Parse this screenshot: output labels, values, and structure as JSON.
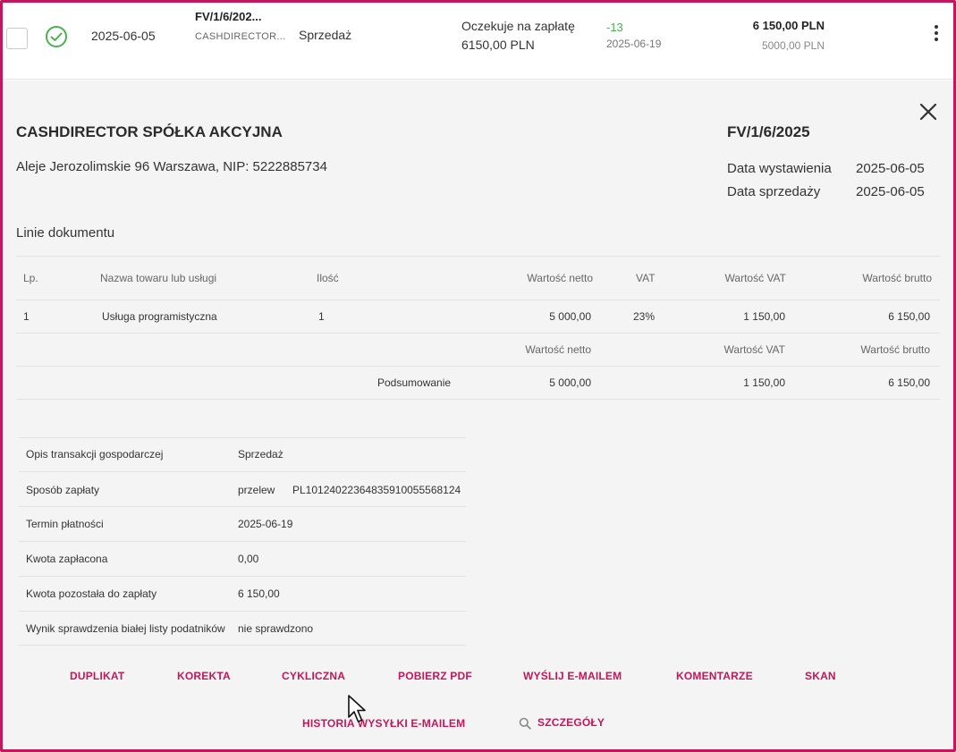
{
  "row": {
    "date": "2025-06-05",
    "number": "FV/1/6/202...",
    "client": "CASHDIRECTOR...",
    "type": "Sprzedaż",
    "status": "Oczekuje na zapłatę",
    "status_amount": "6150,00 PLN",
    "days": "-13",
    "due_date": "2025-06-19",
    "gross": "6 150,00 PLN",
    "net": "5000,00 PLN",
    "status_color": "#4caf50"
  },
  "details": {
    "company": "CASHDIRECTOR SPÓŁKA AKCYJNA",
    "address": "Aleje Jerozolimskie 96 Warszawa, NIP: 5222885734",
    "doc_number": "FV/1/6/2025",
    "issue_label": "Data wystawienia",
    "issue_date": "2025-06-05",
    "sale_label": "Data sprzedaży",
    "sale_date": "2025-06-05",
    "lines_title": "Linie dokumentu"
  },
  "lines_table": {
    "headers": {
      "lp": "Lp.",
      "name": "Nazwa towaru lub usługi",
      "qty": "Ilość",
      "net": "Wartość netto",
      "vat": "VAT",
      "vat_value": "Wartość VAT",
      "gross": "Wartość brutto"
    },
    "row": {
      "lp": "1",
      "name": "Usługa programistyczna",
      "qty": "1",
      "net": "5 000,00",
      "vat": "23%",
      "vat_value": "1 150,00",
      "gross": "6 150,00"
    },
    "summary_headers": {
      "net": "Wartość netto",
      "vat_value": "Wartość VAT",
      "gross": "Wartość brutto"
    },
    "summary": {
      "label": "Podsumowanie",
      "net": "5 000,00",
      "vat_value": "1 150,00",
      "gross": "6 150,00"
    }
  },
  "info": {
    "desc_label": "Opis transakcji gospodarczej",
    "desc_value": "Sprzedaż",
    "payment_label": "Sposób zapłaty",
    "payment_method": "przelew",
    "payment_account": "PL10124022364835910055568124",
    "due_label": "Termin płatności",
    "due_value": "2025-06-19",
    "paid_label": "Kwota zapłacona",
    "paid_value": "0,00",
    "remaining_label": "Kwota pozostała do zapłaty",
    "remaining_value": "6 150,00",
    "whitelist_label": "Wynik sprawdzenia białej listy podatników",
    "whitelist_value": "nie sprawdzono"
  },
  "actions": {
    "duplicate": "DUPLIKAT",
    "correction": "KOREKTA",
    "cyclic": "CYKLICZNA",
    "download_pdf": "POBIERZ PDF",
    "send_email": "WYŚLIJ E-MAILEM",
    "comments": "KOMENTARZE",
    "scan": "SKAN",
    "email_history": "HISTORIA WYSYŁKI E-MAILEM",
    "details": "SZCZEGÓŁY"
  },
  "colors": {
    "accent": "#c2185b",
    "panel_bg": "#f4f4f4"
  },
  "icons": [
    "check-circle-icon",
    "kebab-menu-icon",
    "close-icon",
    "search-icon",
    "mouse-cursor-icon"
  ]
}
